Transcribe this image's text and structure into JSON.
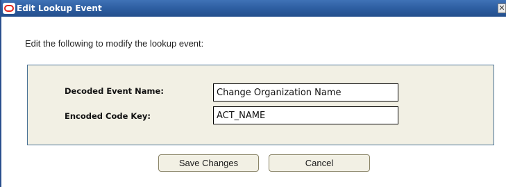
{
  "dialog": {
    "title": "Edit Lookup Event",
    "logo_icon": "oracle-logo-icon",
    "close_label": "✕",
    "instruction": "Edit the following to modify the lookup event:",
    "title_color": "#2c5c9f",
    "panel_color": "#f2f0e4"
  },
  "form": {
    "decoded_label": "Decoded Event Name:",
    "decoded_value": "Change Organization Name",
    "encoded_label": "Encoded Code Key:",
    "encoded_value": "ACT_NAME"
  },
  "buttons": {
    "save_label": "Save Changes",
    "cancel_label": "Cancel"
  }
}
